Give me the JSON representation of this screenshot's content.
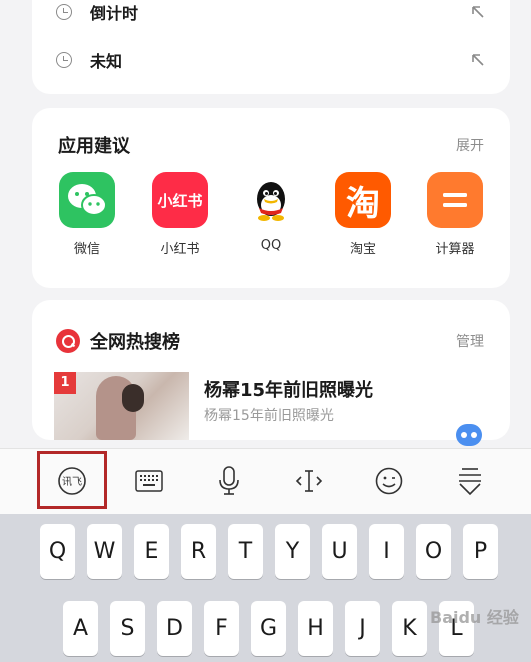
{
  "history": {
    "items": [
      {
        "label": "倒计时"
      },
      {
        "label": "未知"
      }
    ]
  },
  "app_suggestions": {
    "title": "应用建议",
    "expand_label": "展开",
    "apps": [
      {
        "name": "微信",
        "icon": "wechat-icon",
        "color": "#2ec361"
      },
      {
        "name": "小红书",
        "icon": "xiaohongshu-icon",
        "color": "#fe2c47",
        "icon_text": "小红书"
      },
      {
        "name": "QQ",
        "icon": "qq-icon",
        "color": "#ffffff"
      },
      {
        "name": "淘宝",
        "icon": "taobao-icon",
        "color": "#ff5a00",
        "icon_text": "淘"
      },
      {
        "name": "计算器",
        "icon": "calculator-icon",
        "color": "#ff7a2e"
      }
    ]
  },
  "hot_search": {
    "title": "全网热搜榜",
    "manage_label": "管理",
    "items": [
      {
        "rank": "1",
        "headline": "杨幂15年前旧照曝光",
        "subtitle": "杨幂15年前旧照曝光"
      }
    ]
  },
  "keyboard_toolbar": {
    "buttons": [
      {
        "name": "handwriting-mode-icon",
        "label": "讯飞"
      },
      {
        "name": "keyboard-icon"
      },
      {
        "name": "microphone-icon"
      },
      {
        "name": "text-cursor-icon"
      },
      {
        "name": "emoji-icon"
      },
      {
        "name": "collapse-keyboard-icon"
      }
    ]
  },
  "keyboard": {
    "row1": [
      "Q",
      "W",
      "E",
      "R",
      "T",
      "Y",
      "U",
      "I",
      "O",
      "P"
    ],
    "row2": [
      "A",
      "S",
      "D",
      "F",
      "G",
      "H",
      "J",
      "K",
      "L"
    ]
  },
  "watermark": "Baidu 经验",
  "colors": {
    "accent_red": "#e53a3a",
    "highlight_border": "#b32828",
    "keyboard_bg": "#d5d7dd"
  }
}
